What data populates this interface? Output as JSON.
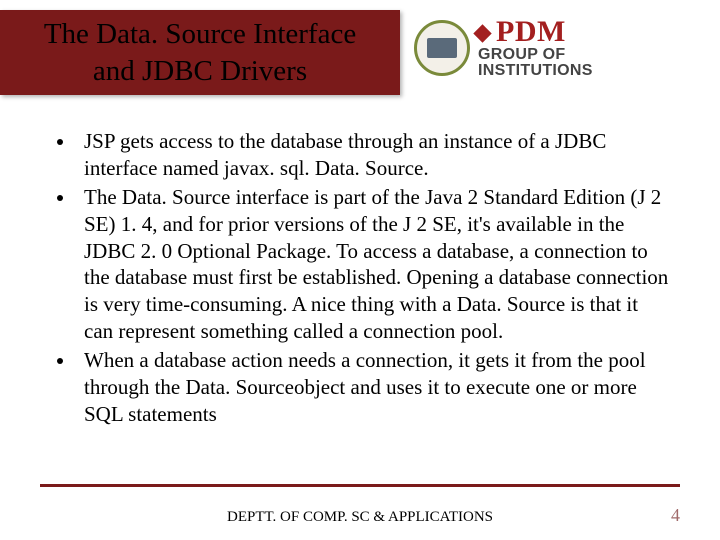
{
  "header": {
    "title": "The Data. Source Interface\nand JDBC Drivers",
    "logo": {
      "brand": "PDM",
      "line1": "GROUP OF",
      "line2": "INSTITUTIONS"
    }
  },
  "bullets": [
    "JSP  gets access to the database through an  instance of a JDBC interface named  javax. sql. Data. Source.",
    "The Data. Source interface is part of the Java 2 Standard Edition (J 2 SE) 1. 4, and for prior versions of the J 2 SE, it's available in the JDBC 2. 0 Optional Package. To access a database, a connection to the database must first be established. Opening a database connection is very time-consuming. A nice thing with a Data. Source is that it can represent something called a connection pool.",
    "When a database action needs a connection, it gets it from the pool through the Data. Sourceobject and uses it to execute one or more SQL statements"
  ],
  "footer": {
    "dept": "DEPTT. OF COMP. SC & APPLICATIONS",
    "page": "4"
  }
}
